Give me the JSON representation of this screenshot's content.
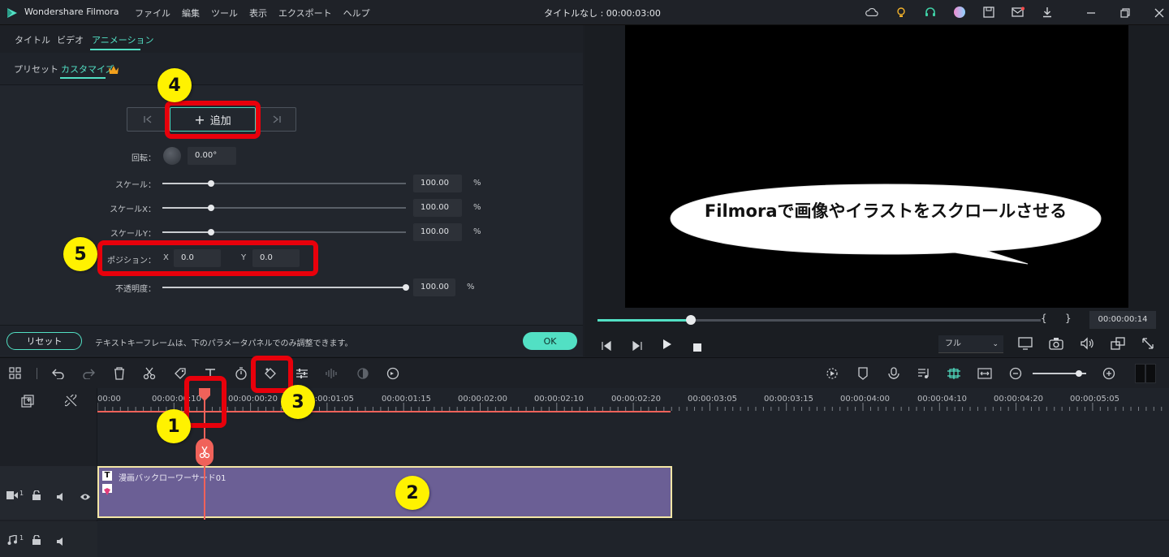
{
  "app": {
    "name": "Wondershare Filmora",
    "menu": [
      "ファイル",
      "編集",
      "ツール",
      "表示",
      "エクスポート",
      "ヘルプ"
    ],
    "project_title": "タイトルなし : 00:00:03:00"
  },
  "panel": {
    "tabs": [
      "タイトル",
      "ビデオ",
      "アニメーション"
    ],
    "subtabs": [
      "プリセット",
      "カスタマイズ"
    ],
    "add_label": "追加",
    "params": {
      "rotation_label": "回転：",
      "rotation_value": "0.00°",
      "scale_label": "スケール：",
      "scale_value": "100.00",
      "scalex_label": "スケールX：",
      "scalex_value": "100.00",
      "scaley_label": "スケールY：",
      "scaley_value": "100.00",
      "position_label": "ポジション：",
      "pos_x_label": "X",
      "pos_x_value": "0.0",
      "pos_y_label": "Y",
      "pos_y_value": "0.0",
      "opacity_label": "不透明度：",
      "opacity_value": "100.00",
      "percent": "%"
    },
    "slider_levels": {
      "scale": 0.2,
      "scalex": 0.2,
      "scaley": 0.2,
      "opacity": 1.0
    },
    "reset_label": "リセット",
    "hint": "テキストキーフレームは、下のパラメータパネルでのみ調整できます。",
    "ok_label": "OK"
  },
  "preview": {
    "caption": "Filmoraで画像やイラストをスクロールさせる",
    "timecode": "00:00:00:14",
    "brace_open": "{",
    "brace_close": "}",
    "quality": "フル",
    "progress": 0.21
  },
  "timeline": {
    "ticks": [
      "00:00",
      "00:00:00:10",
      "00:00:00:20",
      "00:00:01:05",
      "00:00:01:15",
      "00:00:02:00",
      "00:00:02:10",
      "00:00:02:20",
      "00:00:03:05",
      "00:00:03:15",
      "00:00:04:00",
      "00:00:04:10",
      "00:00:04:20",
      "00:00:05:05"
    ],
    "clip_name": "漫画バックローワーサード01",
    "video_track": "1",
    "audio_track": "1"
  },
  "annotations": [
    "1",
    "2",
    "3",
    "4",
    "5"
  ],
  "colors": {
    "accent": "#52e0c4",
    "marker": "#fff200",
    "highlight": "#e8000b",
    "clip": "#6b5f95",
    "playhead": "#f0625a"
  }
}
